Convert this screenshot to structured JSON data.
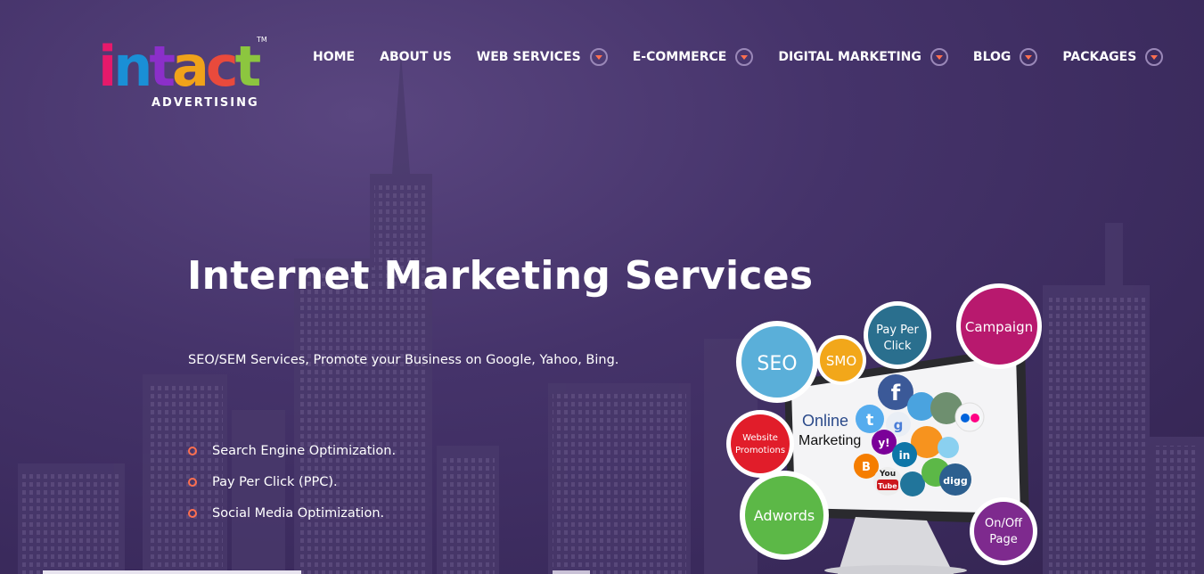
{
  "logo": {
    "letters": [
      "i",
      "n",
      "t",
      "a",
      "c",
      "t"
    ],
    "letter_colors": [
      "#e6196b",
      "#1a8fd6",
      "#8b2fc9",
      "#f0a21a",
      "#e94a3c",
      "#8cc63f"
    ],
    "tm": "TM",
    "sub": "ADVERTISING"
  },
  "nav": {
    "items": [
      {
        "label": "HOME",
        "dropdown": false
      },
      {
        "label": "ABOUT US",
        "dropdown": false
      },
      {
        "label": "WEB SERVICES",
        "dropdown": true
      },
      {
        "label": "E-COMMERCE",
        "dropdown": true
      },
      {
        "label": "DIGITAL MARKETING",
        "dropdown": true
      },
      {
        "label": "BLOG",
        "dropdown": true
      },
      {
        "label": "PACKAGES",
        "dropdown": true
      }
    ]
  },
  "hero": {
    "title": "Internet Marketing Services",
    "subtitle": "SEO/SEM Services, Promote your Business on Google, Yahoo, Bing.",
    "features": [
      "Search Engine Optimization.",
      "Pay Per Click (PPC).",
      "Social Media Optimization."
    ]
  },
  "graphic": {
    "bubbles": {
      "seo": "SEO",
      "smo": "SMO",
      "ppc_line1": "Pay Per",
      "ppc_line2": "Click",
      "campaign": "Campaign",
      "promo_line1": "Website",
      "promo_line2": "Promotions",
      "adwords": "Adwords",
      "onoff_line1": "On/Off",
      "onoff_line2": "Page"
    },
    "screen_line1": "Online",
    "screen_line2": "Marketing",
    "colors": {
      "seo": "#5aafd9",
      "smo": "#f2a71a",
      "ppc": "#2a6f8e",
      "campaign": "#b8196e",
      "promo": "#e11d2a",
      "adwords": "#5cb847",
      "onoff": "#7e2a8e"
    },
    "icons": {
      "facebook": "f",
      "twitter": "t",
      "google": "g",
      "yahoo": "y!",
      "linkedin": "in",
      "youtube_top": "You",
      "youtube_bottom": "Tube",
      "digg": "digg",
      "blogger": "B"
    }
  },
  "accent_color": "#ff6f4f"
}
